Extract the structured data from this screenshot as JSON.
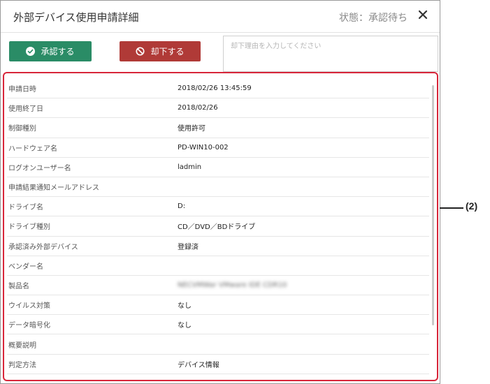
{
  "header": {
    "title": "外部デバイス使用申請詳細",
    "status": "状態：承認待ち",
    "close_icon": "close-icon"
  },
  "actions": {
    "approve_label": "承認する",
    "reject_label": "却下する",
    "reason_placeholder": "却下理由を入力してください",
    "approve_color": "#2a8c66",
    "reject_color": "#b03a37"
  },
  "details": {
    "rows": [
      {
        "label": "申請日時",
        "value": "2018/02/26 13:45:59"
      },
      {
        "label": "使用終了日",
        "value": "2018/02/26"
      },
      {
        "label": "制御種別",
        "value": "使用許可"
      },
      {
        "label": "ハードウェア名",
        "value": "PD-WIN10-002"
      },
      {
        "label": "ログオンユーザー名",
        "value": "ladmin"
      },
      {
        "label": "申請結果通知メールアドレス",
        "value": ""
      },
      {
        "label": "ドライブ名",
        "value": "D:"
      },
      {
        "label": "ドライブ種別",
        "value": "CD／DVD／BDドライブ"
      },
      {
        "label": "承認済み外部デバイス",
        "value": "登録済"
      },
      {
        "label": "ベンダー名",
        "value": ""
      },
      {
        "label": "製品名",
        "value": "NECVMWar VMware IDE CDR10"
      },
      {
        "label": "ウイルス対策",
        "value": "なし"
      },
      {
        "label": "データ暗号化",
        "value": "なし"
      },
      {
        "label": "概要説明",
        "value": ""
      },
      {
        "label": "判定方法",
        "value": "デバイス情報"
      }
    ]
  },
  "callout": {
    "label": "(2)",
    "frame_color": "#d8263a"
  }
}
